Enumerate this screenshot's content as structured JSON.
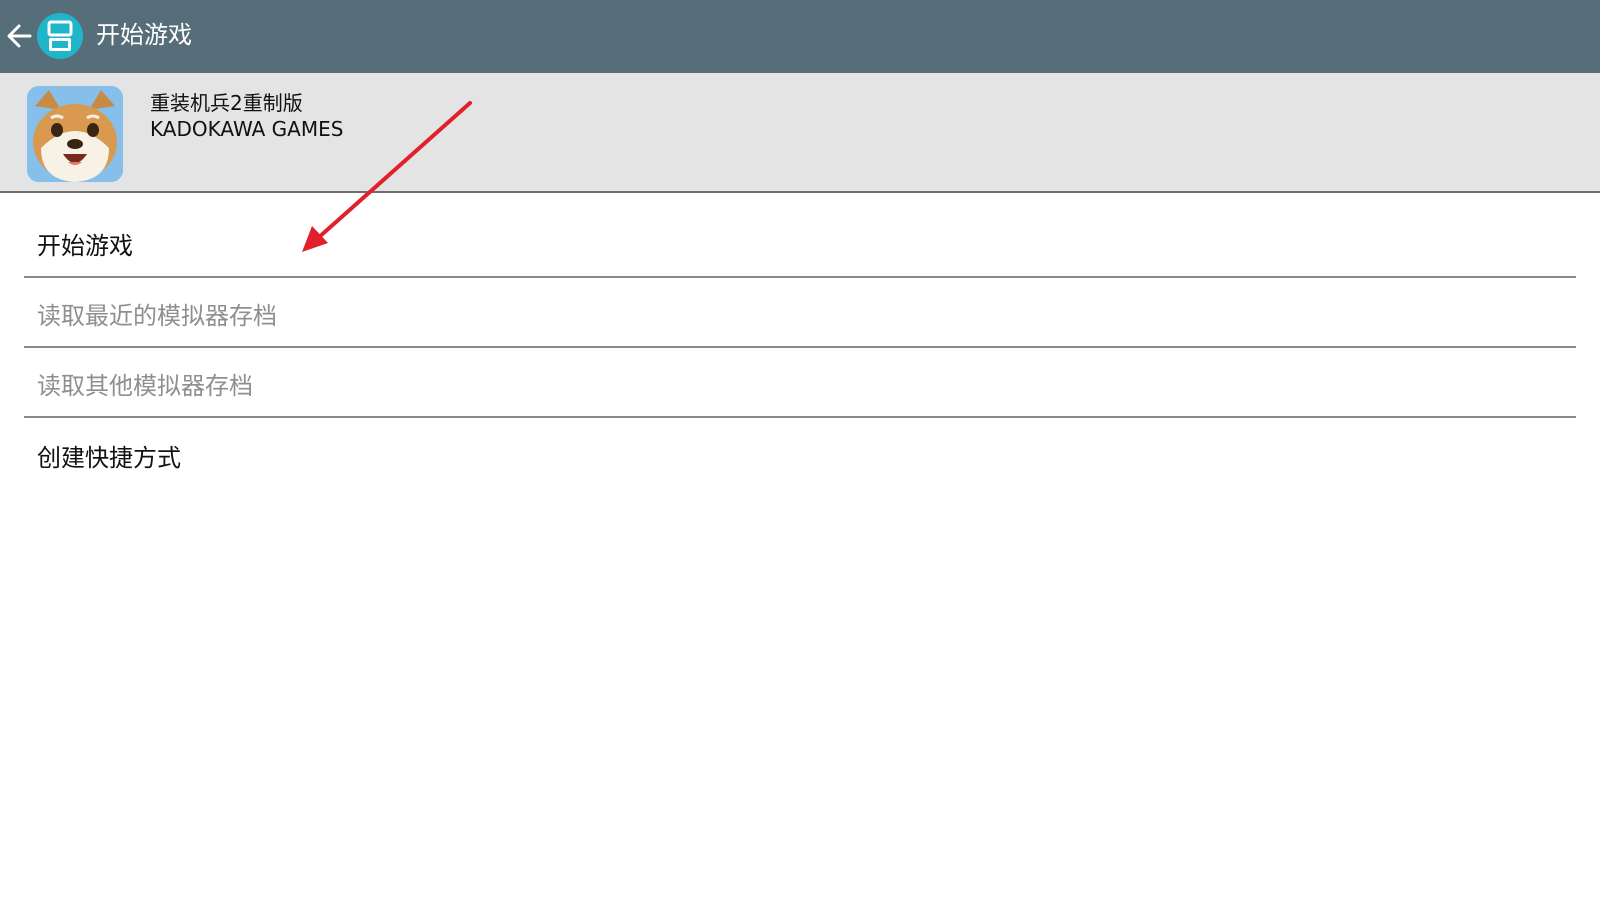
{
  "app_bar": {
    "title": "开始游戏",
    "back_icon": "arrow-left-icon",
    "logo_icon": "dual-screen-console-icon",
    "background_color": "#566e79",
    "logo_color": "#1fb6c9"
  },
  "game": {
    "title": "重装机兵2重制版",
    "publisher": "KADOKAWA GAMES",
    "icon": "shiba-dog-icon",
    "header_color": "#e4e4e4"
  },
  "menu": {
    "items": [
      {
        "label": "开始游戏",
        "enabled": true
      },
      {
        "label": "读取最近的模拟器存档",
        "enabled": false
      },
      {
        "label": "读取其他模拟器存档",
        "enabled": false
      },
      {
        "label": "创建快捷方式",
        "enabled": true
      }
    ]
  },
  "annotation": {
    "arrow_color": "#e0202a"
  }
}
